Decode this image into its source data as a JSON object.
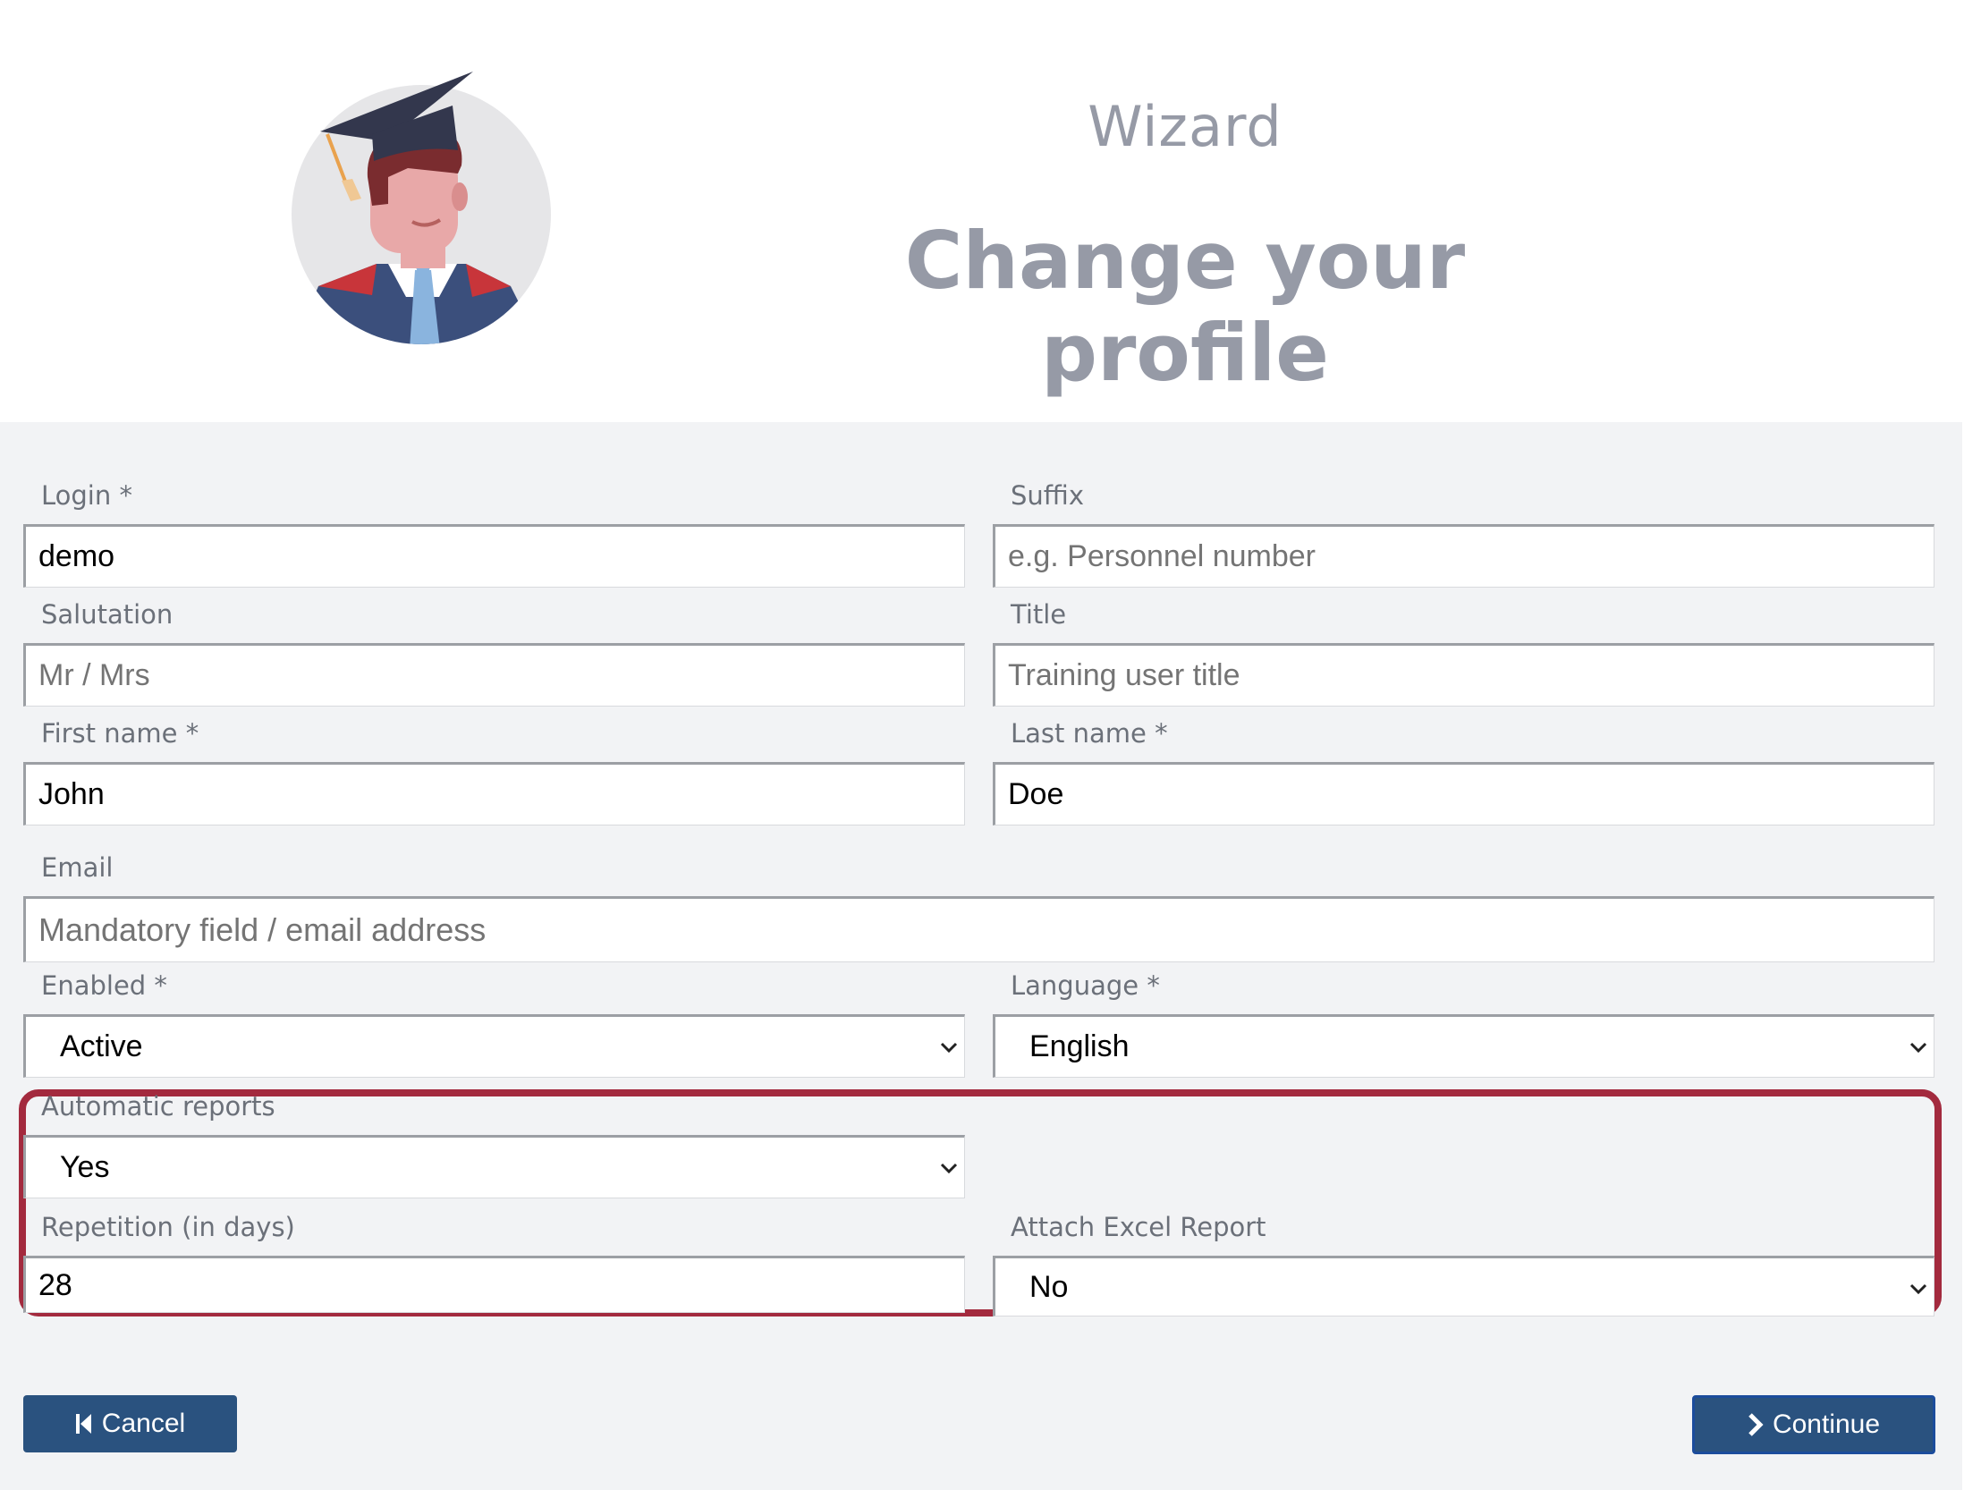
{
  "header": {
    "wizard_label": "Wizard",
    "title": "Change your profile"
  },
  "form": {
    "login": {
      "label": "Login *",
      "value": "demo"
    },
    "suffix": {
      "label": "Suffix",
      "placeholder": "e.g. Personnel number"
    },
    "salutation": {
      "label": "Salutation",
      "placeholder": "Mr / Mrs"
    },
    "title": {
      "label": "Title",
      "placeholder": "Training user title"
    },
    "first_name": {
      "label": "First name *",
      "value": "John"
    },
    "last_name": {
      "label": "Last name *",
      "value": "Doe"
    },
    "email": {
      "label": "Email",
      "placeholder": "Mandatory field / email address"
    },
    "enabled": {
      "label": "Enabled *",
      "value": "Active"
    },
    "language": {
      "label": "Language *",
      "value": "English"
    },
    "automatic_reports": {
      "label": "Automatic reports",
      "value": "Yes"
    },
    "repetition": {
      "label": "Repetition (in days)",
      "value": "28"
    },
    "attach_excel": {
      "label": "Attach Excel Report",
      "value": "No"
    }
  },
  "buttons": {
    "cancel": "Cancel",
    "continue": "Continue"
  },
  "colors": {
    "button": "#2a527f",
    "highlight": "#a32a3e",
    "panel": "#f2f3f5",
    "heading": "#969aa6"
  },
  "icons": {
    "avatar": "graduate-avatar",
    "cancel": "skip-back-icon",
    "continue": "chevron-right-icon",
    "dropdown": "chevron-down-icon"
  }
}
